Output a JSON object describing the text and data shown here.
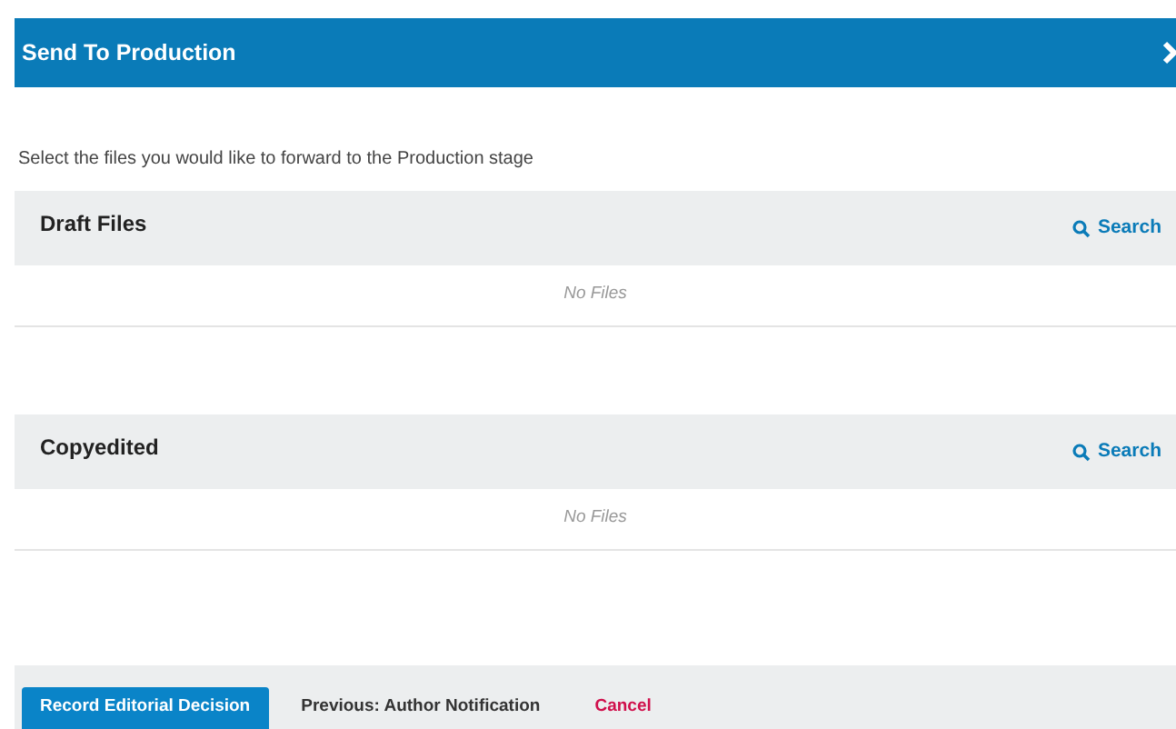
{
  "window": {
    "title": "Send To Production"
  },
  "instructions": "Select the files you would like to forward to the Production stage",
  "grids": [
    {
      "title": "Draft Files",
      "action": "Search",
      "empty": "No Files"
    },
    {
      "title": "Copyedited",
      "action": "Search",
      "empty": "No Files"
    }
  ],
  "buttons": [
    {
      "label": "Record Editorial Decision",
      "kind": "primary"
    },
    {
      "label": "Previous: Author Notification",
      "kind": "plain"
    },
    {
      "label": "Cancel",
      "kind": "cancel"
    }
  ]
}
